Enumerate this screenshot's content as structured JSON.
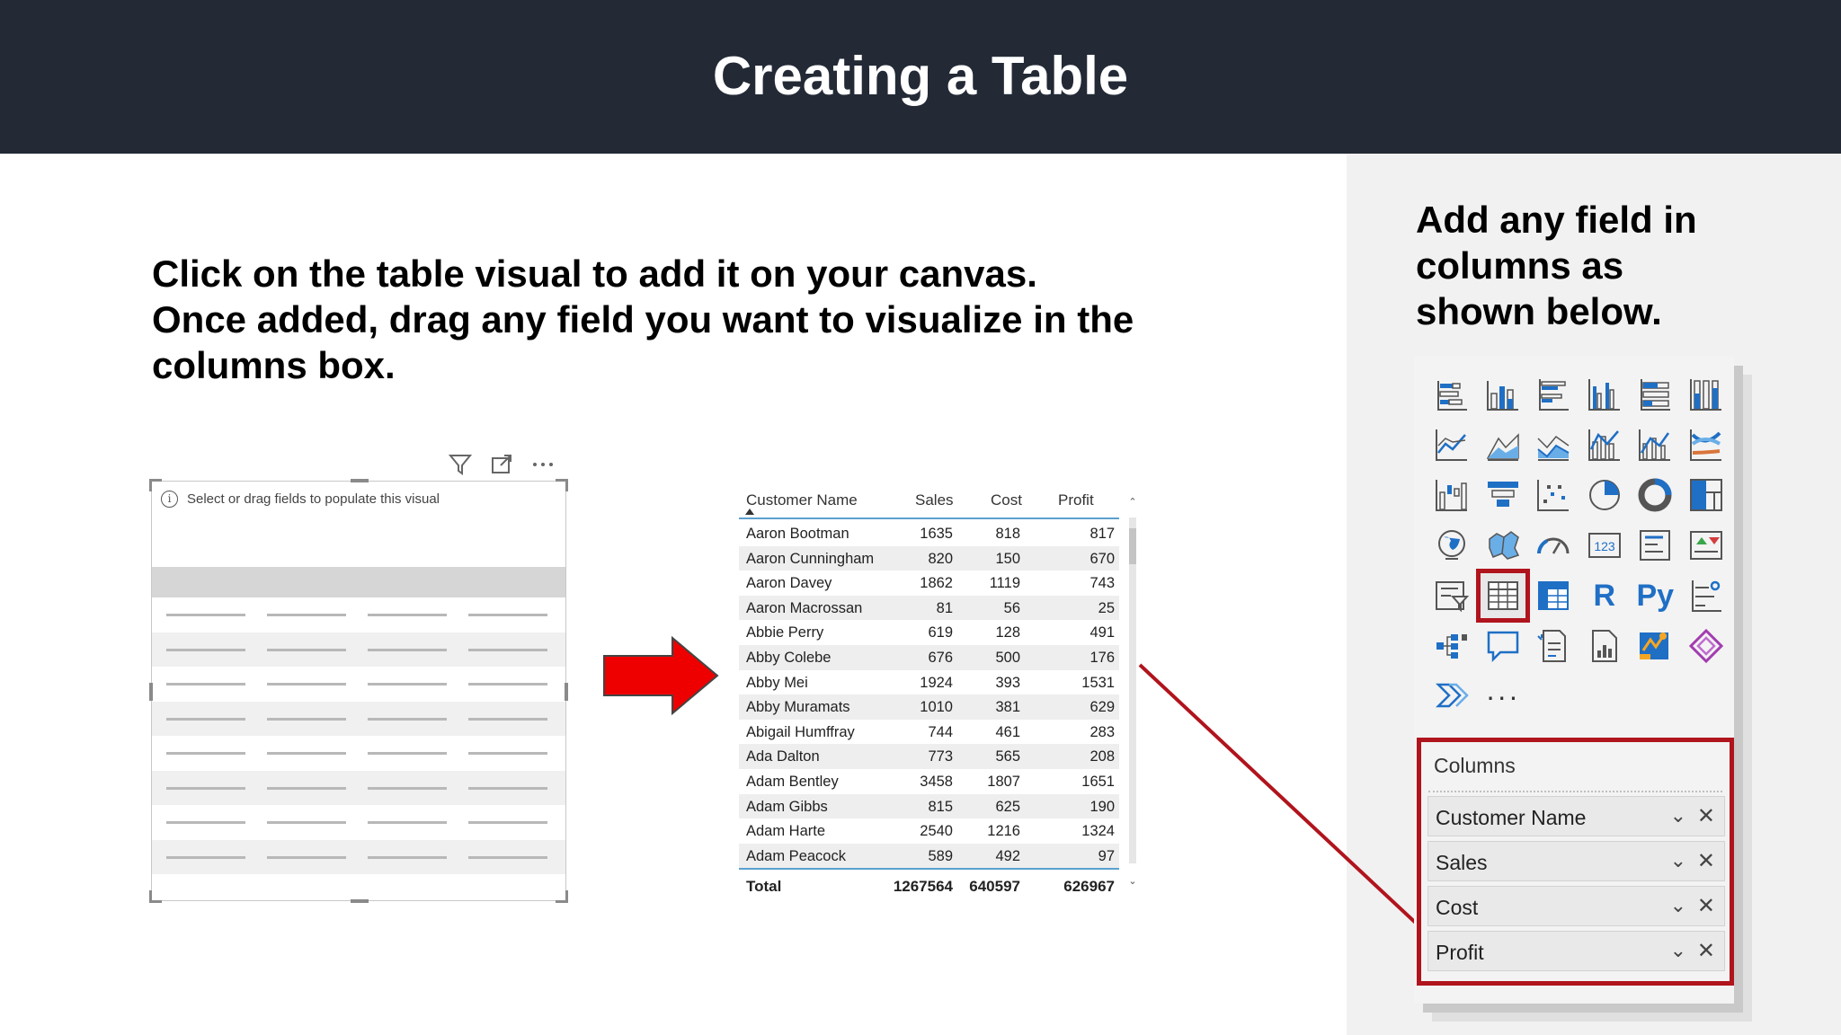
{
  "title": "Creating a Table",
  "instruction": {
    "line1": "Click on the table visual to add it on your canvas.",
    "line2": "Once added, drag any field you want to visualize in the",
    "line3": "columns box."
  },
  "empty_visual": {
    "message": "Select or drag fields to populate this visual",
    "info_icon": "info-icon",
    "toolbar_icons": [
      "filter-icon",
      "focus-mode-icon",
      "more-options-icon"
    ]
  },
  "table": {
    "headers": [
      "Customer Name",
      "Sales",
      "Cost",
      "Profit"
    ],
    "rows": [
      [
        "Aaron Bootman",
        "1635",
        "818",
        "817"
      ],
      [
        "Aaron Cunningham",
        "820",
        "150",
        "670"
      ],
      [
        "Aaron Davey",
        "1862",
        "1119",
        "743"
      ],
      [
        "Aaron Macrossan",
        "81",
        "56",
        "25"
      ],
      [
        "Abbie Perry",
        "619",
        "128",
        "491"
      ],
      [
        "Abby Colebe",
        "676",
        "500",
        "176"
      ],
      [
        "Abby Mei",
        "1924",
        "393",
        "1531"
      ],
      [
        "Abby Muramats",
        "1010",
        "381",
        "629"
      ],
      [
        "Abigail Humffray",
        "744",
        "461",
        "283"
      ],
      [
        "Ada Dalton",
        "773",
        "565",
        "208"
      ],
      [
        "Adam Bentley",
        "3458",
        "1807",
        "1651"
      ],
      [
        "Adam Gibbs",
        "815",
        "625",
        "190"
      ],
      [
        "Adam Harte",
        "2540",
        "1216",
        "1324"
      ],
      [
        "Adam Peacock",
        "589",
        "492",
        "97"
      ]
    ],
    "total": [
      "Total",
      "1267564",
      "640597",
      "626967"
    ]
  },
  "right": {
    "caption1": "Add any field in",
    "caption2": "columns as",
    "caption3": "shown below.",
    "visuals": [
      "stacked-bar-chart-icon",
      "stacked-column-chart-icon",
      "clustered-bar-chart-icon",
      "clustered-column-chart-icon",
      "100-stacked-bar-chart-icon",
      "100-stacked-column-chart-icon",
      "line-chart-icon",
      "area-chart-icon",
      "stacked-area-chart-icon",
      "line-and-column-chart-icon",
      "line-and-clustered-column-chart-icon",
      "ribbon-chart-icon",
      "waterfall-chart-icon",
      "funnel-chart-icon",
      "scatter-chart-icon",
      "pie-chart-icon",
      "donut-chart-icon",
      "treemap-icon",
      "map-icon",
      "filled-map-icon",
      "gauge-icon",
      "card-icon",
      "multi-row-card-icon",
      "kpi-icon",
      "slicer-icon",
      "table-icon",
      "matrix-icon",
      "r-script-visual-icon",
      "python-visual-icon",
      "key-influencers-icon",
      "decomposition-tree-icon",
      "qa-icon",
      "smart-narrative-icon",
      "paginated-report-icon",
      "arcgis-map-icon",
      "power-apps-icon",
      "power-automate-icon",
      "more-visuals-icon"
    ],
    "r_label": "R",
    "py_label": "Py",
    "more_label": "···",
    "columns_label": "Columns",
    "fields": [
      "Customer Name",
      "Sales",
      "Cost",
      "Profit"
    ]
  },
  "colors": {
    "title_bg": "#232a36",
    "highlight_red": "#b0141d",
    "arrow_red": "#ee0000",
    "accent_blue": "#1f6fc5"
  }
}
